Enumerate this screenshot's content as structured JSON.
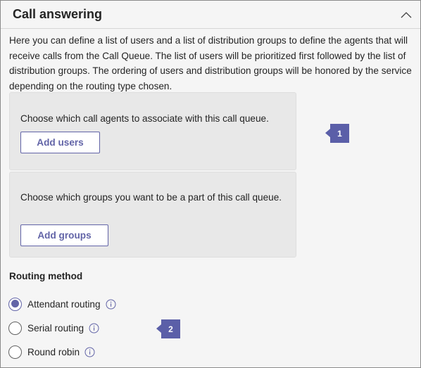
{
  "header": {
    "title": "Call answering",
    "collapse_icon": "chevron-up-icon"
  },
  "intro": {
    "text": "Here you can define a list of users and a list of distribution groups to define the agents that will receive calls from the Call Queue.  The list of users will be prioritized first followed by the list of distribution groups.  The ordering of users and distribution groups will be honored by the service depending on the routing type chosen."
  },
  "users_card": {
    "text": "Choose which call agents to associate with this call queue.",
    "button_label": "Add users"
  },
  "groups_card": {
    "text": "Choose which groups you want to be a part of this call queue.",
    "button_label": "Add groups"
  },
  "callouts": [
    {
      "label": "1"
    },
    {
      "label": "2"
    }
  ],
  "routing": {
    "label": "Routing method",
    "options": [
      {
        "label": "Attendant routing",
        "checked": true,
        "info_icon": "info-icon"
      },
      {
        "label": "Serial routing",
        "checked": false,
        "info_icon": "info-icon"
      },
      {
        "label": "Round robin",
        "checked": false,
        "info_icon": "info-icon"
      }
    ]
  },
  "colors": {
    "accent": "#6264a7",
    "callout": "#5b5fa8",
    "panel_bg": "#f5f5f5",
    "card_bg": "#e8e8e8"
  }
}
